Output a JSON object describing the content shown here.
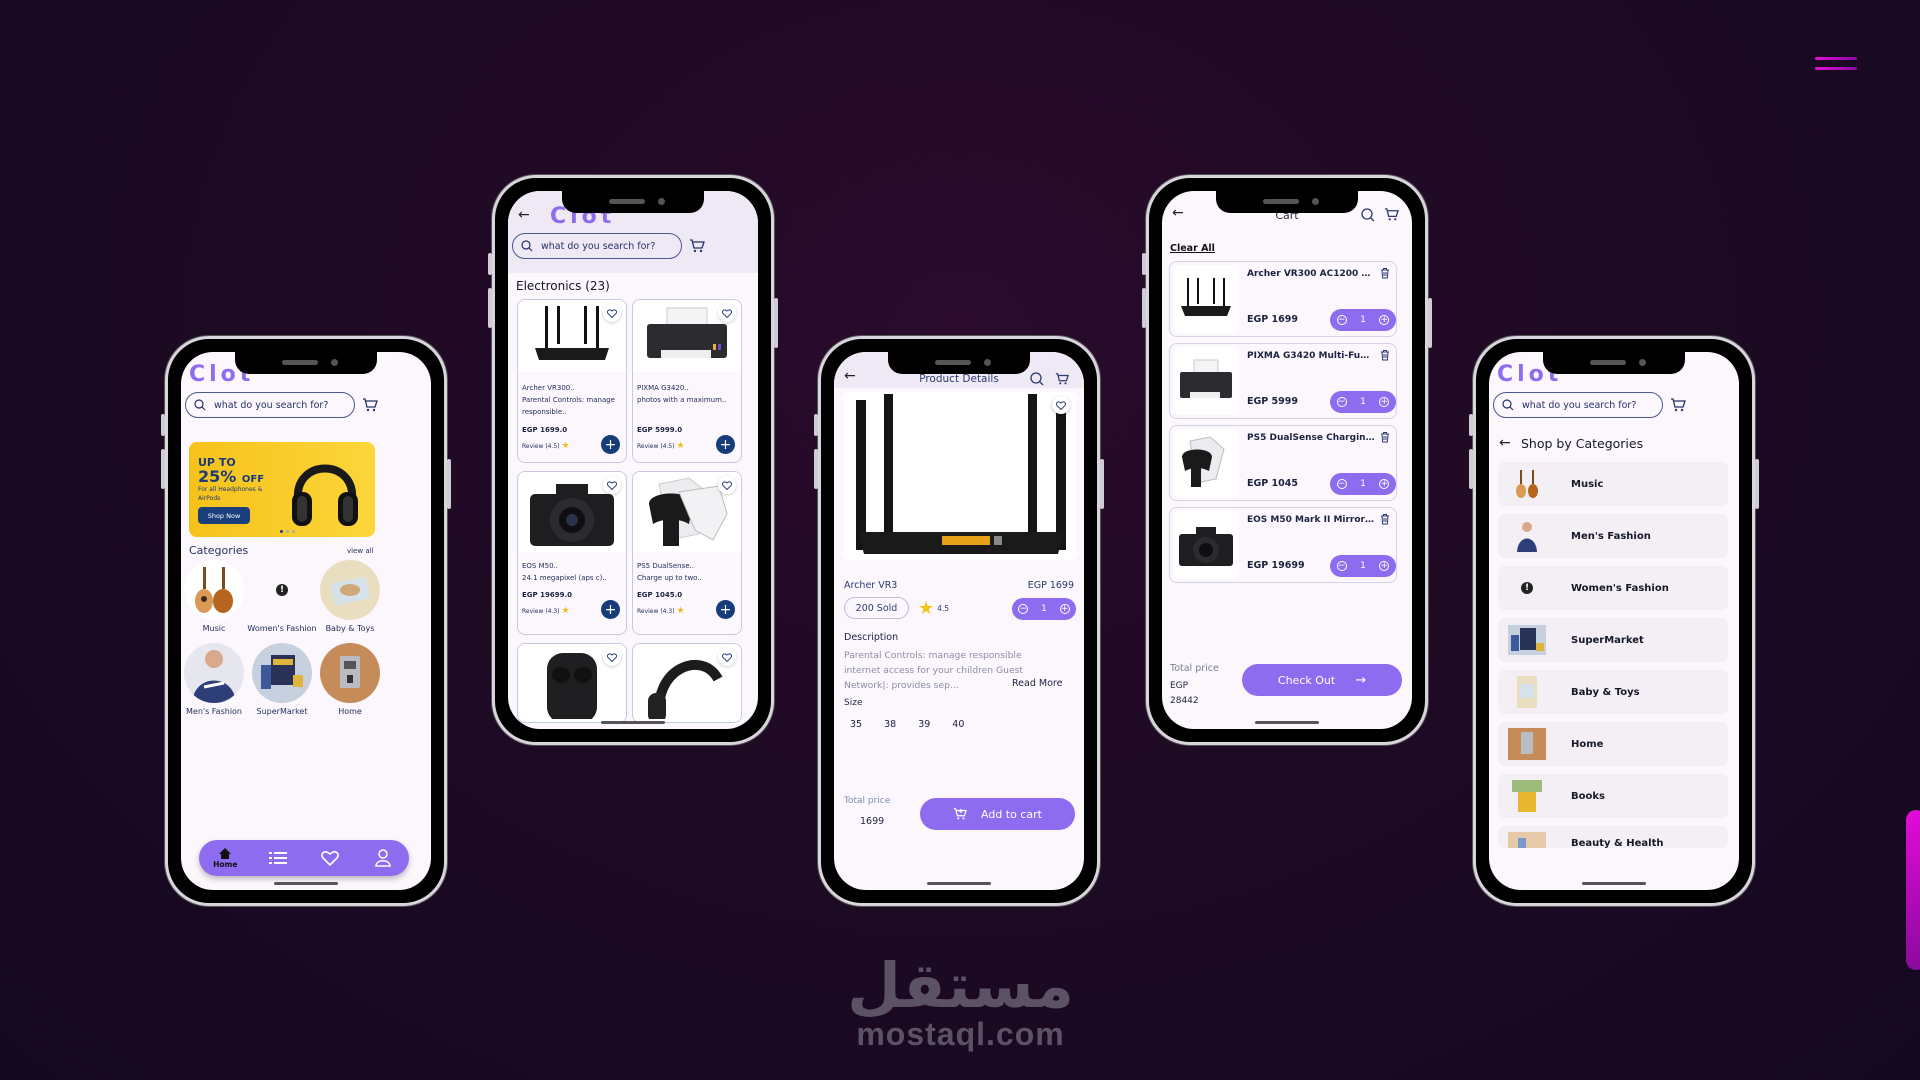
{
  "decor": {
    "menu_icon": "hamburger-menu-icon"
  },
  "watermark": {
    "arabic": "مستقل",
    "latin": "mostaql.com"
  },
  "colors": {
    "accent": "#8e6cef",
    "navy": "#163c7a",
    "background": "#1f0a24",
    "screen": "#fcf6fd",
    "banner_yellow": "#f6c21a"
  },
  "app": {
    "logo": "Clot",
    "search_placeholder": "what do you search for?"
  },
  "home": {
    "banner": {
      "line1": "UP TO",
      "percent": "25%",
      "off": "OFF",
      "subtitle": "For all Headphones & AirPods",
      "button": "Shop Now",
      "slides": 3,
      "active_slide": 1
    },
    "categories_title": "Categories",
    "view_all": "view all",
    "categories": [
      {
        "label": "Music",
        "icon": "guitar-icon"
      },
      {
        "label": "Women's Fashion",
        "icon": "error-icon"
      },
      {
        "label": "Baby & Toys",
        "icon": "baby-icon"
      },
      {
        "label": "Men's Fashion",
        "icon": "hoodie-icon"
      },
      {
        "label": "SuperMarket",
        "icon": "grocery-icon"
      },
      {
        "label": "Home",
        "icon": "appliance-icon"
      }
    ],
    "nav": [
      {
        "label": "Home",
        "icon": "home-icon",
        "active": true
      },
      {
        "label": "",
        "icon": "list-icon"
      },
      {
        "label": "",
        "icon": "heart-icon"
      },
      {
        "label": "",
        "icon": "profile-icon"
      }
    ]
  },
  "listing": {
    "title": "Electronics (23)",
    "products": [
      {
        "name": "Archer VR300..",
        "desc": "Parental Controls: manage responsible..",
        "price": "EGP 1699.0",
        "review": "Review (4.5)",
        "image": "router"
      },
      {
        "name": "PIXMA G3420..",
        "desc": "photos with a maximum..",
        "price": "EGP 5999.0",
        "review": "Review (4.5)",
        "image": "printer"
      },
      {
        "name": "EOS M50..",
        "desc": "24.1 megapixel (aps c)..",
        "price": "EGP 19699.0",
        "review": "Review (4.3)",
        "image": "camera"
      },
      {
        "name": "PS5 DualSense..",
        "desc": "Charge up to two..",
        "price": "EGP 1045.0",
        "review": "Review (4.3)",
        "image": "controller"
      },
      {
        "name": "",
        "desc": "",
        "price": "",
        "review": "",
        "image": "earbuds"
      },
      {
        "name": "",
        "desc": "",
        "price": "",
        "review": "",
        "image": "headphones"
      }
    ]
  },
  "details": {
    "title": "Product Details",
    "name": "Archer VR3",
    "price": "EGP 1699",
    "sold": "200 Sold",
    "rating": "4.5",
    "quantity": "1",
    "description_title": "Description",
    "description": "Parental Controls: manage responsible internet access for your children Guest Network|: provides sep...",
    "read_more": "Read More",
    "size_title": "Size",
    "sizes": [
      "35",
      "38",
      "39",
      "40"
    ],
    "total_label": "Total price",
    "total_value": "1699",
    "add_to_cart": "Add to cart"
  },
  "cart": {
    "title": "Cart",
    "clear_all": "Clear All",
    "items": [
      {
        "name": "Archer VR300 AC1200 Wi...",
        "price": "EGP 1699",
        "qty": "1",
        "image": "router"
      },
      {
        "name": "PIXMA G3420 Multi-Func...",
        "price": "EGP 5999",
        "qty": "1",
        "image": "printer"
      },
      {
        "name": "PS5 DualSense Chargin...",
        "price": "EGP 1045",
        "qty": "1",
        "image": "controller"
      },
      {
        "name": "EOS M50 Mark II Mirrorle...",
        "price": "EGP 19699",
        "qty": "1",
        "image": "camera"
      }
    ],
    "total_label": "Total price",
    "total_currency": "EGP",
    "total_value": "28442",
    "checkout": "Check Out"
  },
  "shop_categories": {
    "title": "Shop by Categories",
    "items": [
      {
        "label": "Music",
        "thumb": "guitar"
      },
      {
        "label": "Men's Fashion",
        "thumb": "hoodie"
      },
      {
        "label": "Women's Fashion",
        "thumb": "error"
      },
      {
        "label": "SuperMarket",
        "thumb": "grocery"
      },
      {
        "label": "Baby & Toys",
        "thumb": "baby"
      },
      {
        "label": "Home",
        "thumb": "appliance"
      },
      {
        "label": "Books",
        "thumb": "book"
      },
      {
        "label": "Beauty & Health",
        "thumb": "beauty"
      }
    ]
  }
}
